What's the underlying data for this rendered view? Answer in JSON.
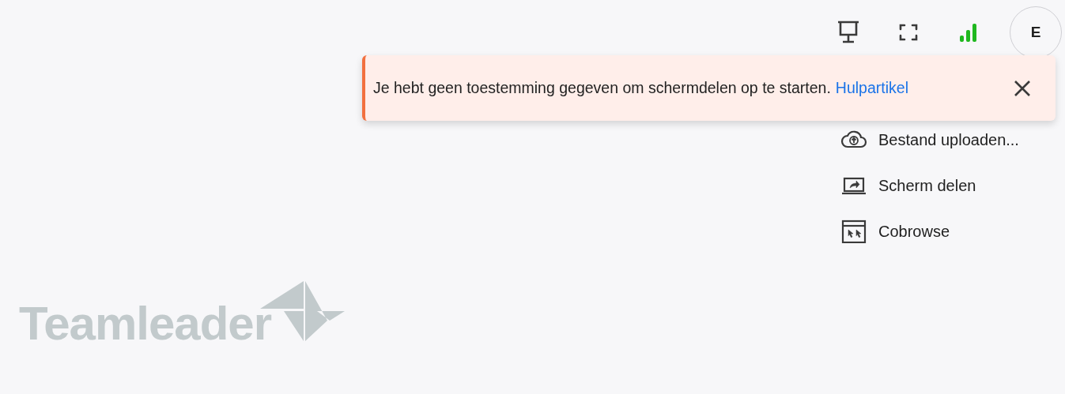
{
  "toolbar": {
    "avatar": "E"
  },
  "notification": {
    "message": "Je hebt geen toestemming gegeven om schermdelen op te starten.",
    "link": "Hulpartikel"
  },
  "menu": [
    {
      "kind": "upload",
      "label": "Bestand uploaden..."
    },
    {
      "kind": "share",
      "label": "Scherm delen"
    },
    {
      "kind": "cobrowse",
      "label": "Cobrowse"
    }
  ],
  "logo": {
    "text": "Teamleader"
  }
}
